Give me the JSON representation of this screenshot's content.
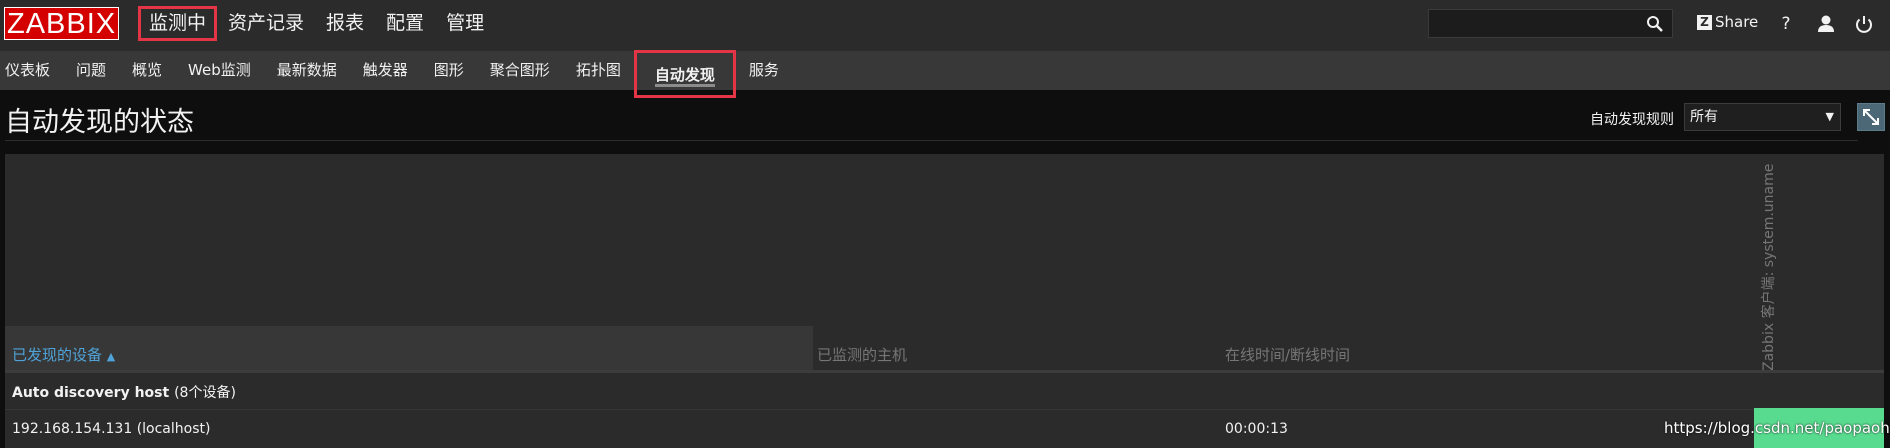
{
  "logo": "ZABBIX",
  "main_nav": [
    {
      "label": "监测中",
      "active": true
    },
    {
      "label": "资产记录"
    },
    {
      "label": "报表"
    },
    {
      "label": "配置"
    },
    {
      "label": "管理"
    }
  ],
  "topbar": {
    "search_value": "",
    "share_label": "Share",
    "help_label": "?"
  },
  "sub_nav": [
    {
      "label": "仪表板"
    },
    {
      "label": "问题"
    },
    {
      "label": "概览"
    },
    {
      "label": "Web监测"
    },
    {
      "label": "最新数据"
    },
    {
      "label": "触发器"
    },
    {
      "label": "图形"
    },
    {
      "label": "聚合图形"
    },
    {
      "label": "拓扑图"
    },
    {
      "label": "自动发现",
      "active": true
    },
    {
      "label": "服务"
    }
  ],
  "page": {
    "title": "自动发现的状态",
    "filter_label": "自动发现规则",
    "filter_value": "所有"
  },
  "table": {
    "headers": {
      "discovered_device": "已发现的设备",
      "sort_indicator": "▲",
      "monitored_host": "已监测的主机",
      "uptime_downtime": "在线时间/断线时间",
      "check_column": "Zabbix 客户端: system.uname"
    },
    "group": {
      "name": "Auto discovery host",
      "count": "(8个设备)"
    },
    "rows": [
      {
        "device": "192.168.154.131 (localhost)",
        "host": "",
        "uptime": "00:00:13",
        "status_color": "#59db8f"
      }
    ]
  },
  "watermark": "https://blog.csdn.net/paopaohll"
}
